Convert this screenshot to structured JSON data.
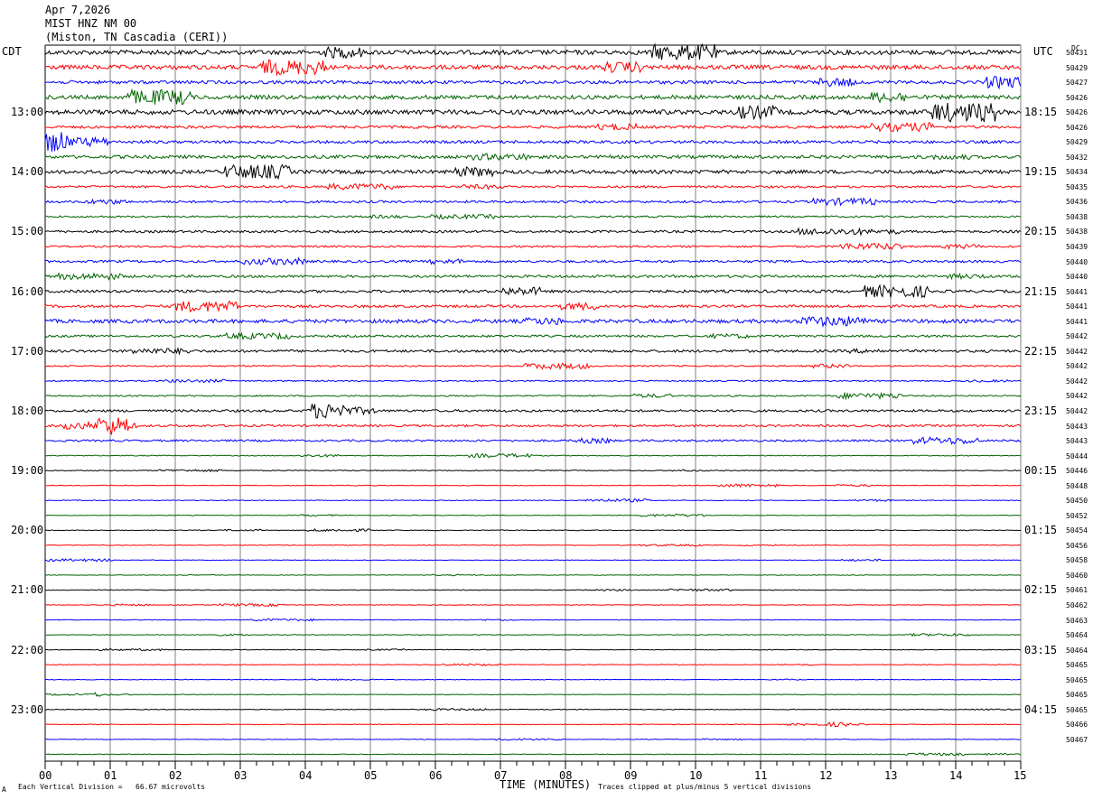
{
  "header": {
    "date": "Apr 7,2026",
    "station": "MIST HNZ NM 00",
    "location": "(Miston, TN Cascadia (CERI))"
  },
  "left_timezone": "CDT",
  "right_timezone": "UTC",
  "dc_label": "DC",
  "footer": {
    "scale_text": "Each Vertical Division =   66.67 microvolts",
    "clip_text": "Traces clipped at plus/minus 5 vertical divisions",
    "corner_mark": "A"
  },
  "colors": {
    "trace_cycle": [
      "#000000",
      "#ff0000",
      "#0000ff",
      "#006400"
    ],
    "grid": "#808080"
  },
  "chart_data": {
    "type": "line",
    "xlabel": "TIME (MINUTES)",
    "x_range": [
      0,
      15
    ],
    "x_ticks": [
      "00",
      "01",
      "02",
      "03",
      "04",
      "05",
      "06",
      "07",
      "08",
      "09",
      "10",
      "11",
      "12",
      "13",
      "14",
      "15"
    ],
    "left_hour_labels": [
      "13:00",
      "14:00",
      "15:00",
      "16:00",
      "17:00",
      "18:00",
      "19:00",
      "20:00",
      "21:00",
      "22:00",
      "23:00"
    ],
    "right_hour_labels": [
      "18:15",
      "19:15",
      "20:15",
      "21:15",
      "22:15",
      "23:15",
      "00:15",
      "01:15",
      "02:15",
      "03:15",
      "04:15"
    ],
    "dc_values": [
      "50431",
      "50429",
      "50427",
      "50426",
      "50426",
      "50426",
      "50429",
      "50432",
      "50434",
      "50435",
      "50436",
      "50438",
      "50438",
      "50439",
      "50440",
      "50440",
      "50441",
      "50441",
      "50441",
      "50442",
      "50442",
      "50442",
      "50442",
      "50442",
      "50442",
      "50443",
      "50443",
      "50444",
      "50446",
      "50448",
      "50450",
      "50452",
      "50454",
      "50456",
      "50458",
      "50460",
      "50461",
      "50462",
      "50463",
      "50464",
      "50464",
      "50465",
      "50465",
      "50465",
      "50465",
      "50466",
      "50467"
    ],
    "trace_count": 48,
    "traces_per_hour": 4,
    "trace_activity": [
      2.5,
      2.4,
      1.8,
      2.2,
      2.6,
      1.5,
      1.6,
      1.8,
      2.0,
      1.2,
      1.3,
      1.0,
      1.3,
      1.1,
      1.3,
      1.4,
      1.5,
      1.4,
      2.0,
      1.2,
      1.4,
      0.8,
      0.7,
      0.8,
      1.3,
      1.2,
      1.1,
      0.5,
      0.5,
      0.4,
      0.4,
      0.35,
      0.4,
      0.35,
      0.35,
      0.35,
      0.4,
      0.35,
      0.35,
      0.35,
      0.35,
      0.35,
      0.35,
      0.35,
      0.4,
      0.35,
      0.35,
      0.35
    ]
  }
}
